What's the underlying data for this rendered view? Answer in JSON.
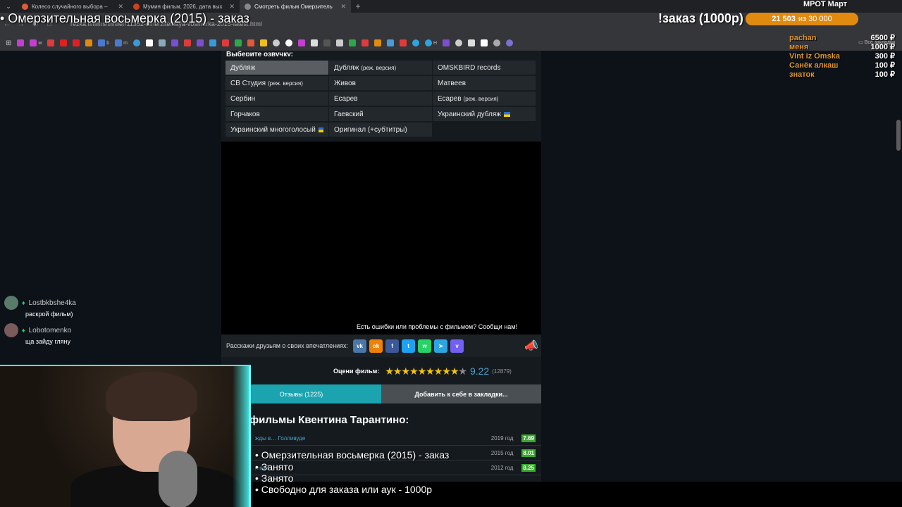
{
  "browser": {
    "tabs": [
      {
        "title": "Колесо случайного выбора –",
        "icon_color": "#e05a3a",
        "active": false
      },
      {
        "title": "Мумия фильм, 2026, дата вых",
        "icon_color": "#d04020",
        "active": false
      },
      {
        "title": "Смотреть фильм Омерзитель",
        "icon_color": "#888888",
        "active": true
      }
    ],
    "url": "rezka.fi/films/thriller/11352-omerzitelnaya-vosmerka-2015-latest.html",
    "bookmark_labels": [
      "м",
      "b",
      "m",
      "Н"
    ],
    "all_bookmarks_label": "Все закладки"
  },
  "overlay": {
    "stream_title": "• Омерзительная восьмерка (2015) - заказ",
    "order_label": "!заказ (1000р)",
    "goal_current": "21 503",
    "goal_total": "из 30 000",
    "mrot_label": "МРОТ Март"
  },
  "donors": [
    {
      "name": "pachan",
      "amount": "6500 ₽"
    },
    {
      "name": "меня",
      "amount": "1000 ₽"
    },
    {
      "name": "Vint iz Omska",
      "amount": "300 ₽"
    },
    {
      "name": "Санёк алкаш",
      "amount": "100 ₽"
    },
    {
      "name": "знаток",
      "amount": "100 ₽"
    }
  ],
  "page": {
    "voice_heading": "Выберите озвучку:",
    "voices": [
      {
        "label": "Дубляж",
        "sub": "",
        "flag": false,
        "active": true
      },
      {
        "label": "Дубляж",
        "sub": "(реж. версия)",
        "flag": false,
        "active": false
      },
      {
        "label": "OMSKBIRD records",
        "sub": "",
        "flag": false,
        "active": false
      },
      {
        "label": "CB Студия",
        "sub": "(реж. версия)",
        "flag": false,
        "active": false
      },
      {
        "label": "Живов",
        "sub": "",
        "flag": false,
        "active": false
      },
      {
        "label": "Матвеев",
        "sub": "",
        "flag": false,
        "active": false
      },
      {
        "label": "Сербин",
        "sub": "",
        "flag": false,
        "active": false
      },
      {
        "label": "Есарев",
        "sub": "",
        "flag": false,
        "active": false
      },
      {
        "label": "Есарев",
        "sub": "(реж. версия)",
        "flag": false,
        "active": false
      },
      {
        "label": "Горчаков",
        "sub": "",
        "flag": false,
        "active": false
      },
      {
        "label": "Гаевский",
        "sub": "",
        "flag": false,
        "active": false
      },
      {
        "label": "Украинский дубляж",
        "sub": "",
        "flag": true,
        "active": false
      },
      {
        "label": "Украинский многоголосый",
        "sub": "",
        "flag": true,
        "active": false
      },
      {
        "label": "Оригинал (+субтитры)",
        "sub": "",
        "flag": false,
        "active": false
      }
    ],
    "report_text": "Есть ошибки или проблемы с фильмом? Сообщи нам!",
    "share_label": "Расскажи друзьям о своих впечатлениях:",
    "social": [
      {
        "name": "vk-icon",
        "glyph": "vk",
        "color": "#4a76a8"
      },
      {
        "name": "odnoklassniki-icon",
        "glyph": "ok",
        "color": "#ee8208"
      },
      {
        "name": "facebook-icon",
        "glyph": "f",
        "color": "#3b5998"
      },
      {
        "name": "twitter-icon",
        "glyph": "t",
        "color": "#1da1f2"
      },
      {
        "name": "whatsapp-icon",
        "glyph": "w",
        "color": "#25d366"
      },
      {
        "name": "telegram-icon",
        "glyph": "➤",
        "color": "#2ca5e0"
      },
      {
        "name": "viber-icon",
        "glyph": "v",
        "color": "#7360f2"
      }
    ],
    "rate_label": "Оцени фильм:",
    "rating": "9.22",
    "votes": "(12879)",
    "stars_filled": 9,
    "stars_total": 10,
    "reviews_button": "Отзывы (1225)",
    "bookmark_button": "Добавить к себе в закладки...",
    "films_title": "фильмы Квентина Тарантино:",
    "films": [
      {
        "name": "жды в… Голливуде",
        "year": "2019 год",
        "rating": "7.69"
      },
      {
        "name": "",
        "year": "2015 год",
        "rating": "8.01"
      },
      {
        "name": "нный",
        "year": "2012 год",
        "rating": "8.25"
      }
    ]
  },
  "chat": [
    {
      "user": "Lostbkbshe4ka",
      "text": "раскрой фильм)"
    },
    {
      "user": "Lobotomenko",
      "text": "ща зайду гляну"
    }
  ],
  "caption": {
    "lines": [
      "• Омерзительная восьмерка (2015) - заказ",
      "• Занято",
      "• Занято",
      "• Свободно для заказа или аук - 1000р"
    ]
  }
}
